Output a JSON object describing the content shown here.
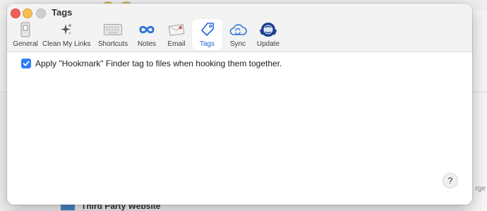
{
  "window": {
    "title": "Tags"
  },
  "tabs": [
    {
      "label": "General",
      "icon": "general-switch-icon"
    },
    {
      "label": "Clean My Links",
      "icon": "sparkles-icon"
    },
    {
      "label": "Shortcuts",
      "icon": "keyboard-icon"
    },
    {
      "label": "Notes",
      "icon": "infinity-icon"
    },
    {
      "label": "Email",
      "icon": "envelope-icon"
    },
    {
      "label": "Tags",
      "icon": "tag-icon"
    },
    {
      "label": "Sync",
      "icon": "cloud-sync-icon"
    },
    {
      "label": "Update",
      "icon": "update-globe-icon"
    }
  ],
  "active_tab": "Tags",
  "content": {
    "checkbox_label": "Apply \"Hookmark\" Finder tag to files when hooking them together.",
    "checkbox_checked": true,
    "help_label": "?"
  },
  "background": {
    "partial_text": "Third Party Website",
    "right_partial": "rge"
  },
  "colors": {
    "accent": "#2f7cf6",
    "active_label": "#2467d6"
  }
}
